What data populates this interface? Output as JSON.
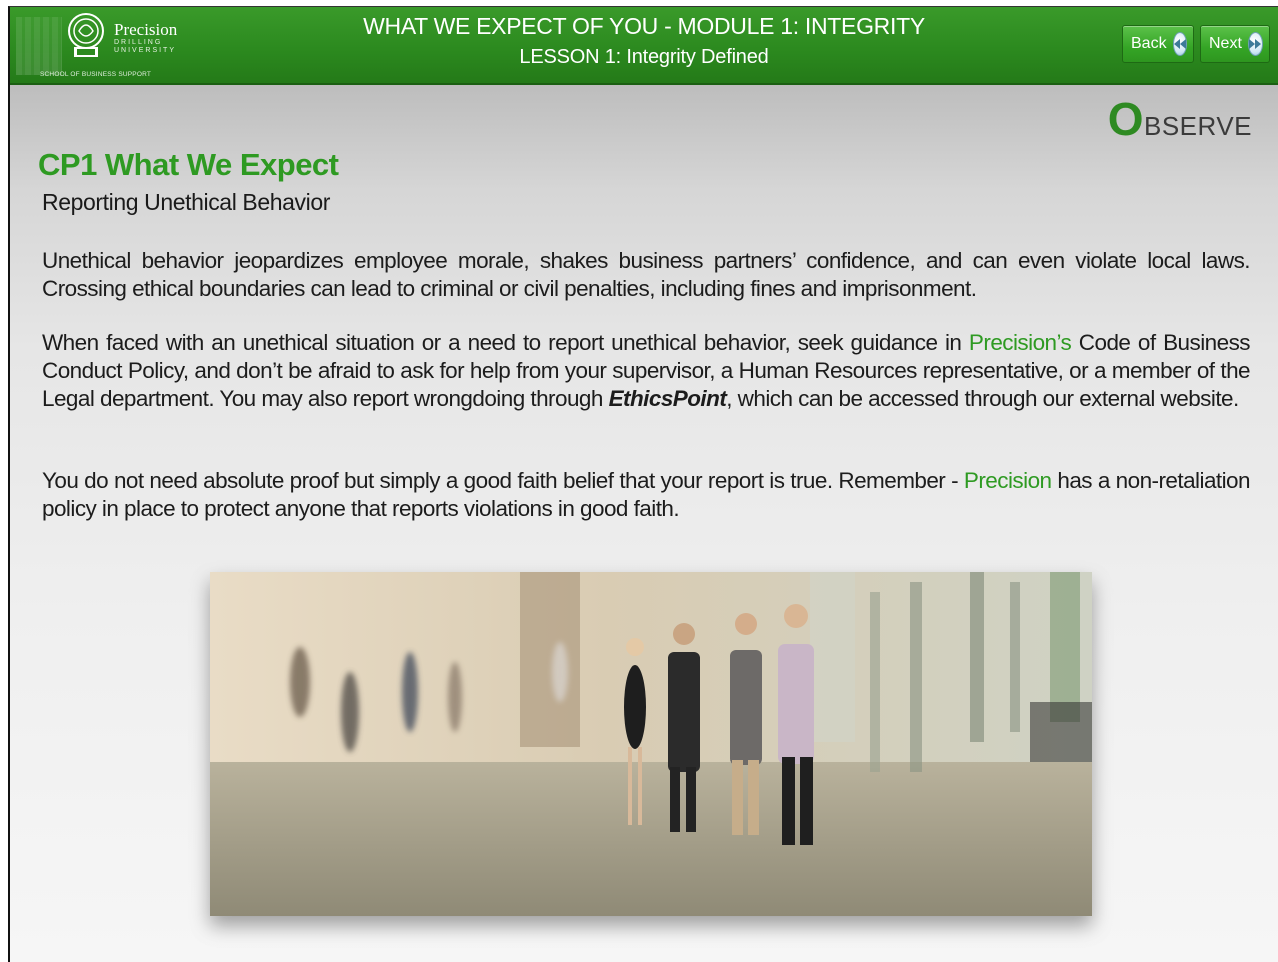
{
  "header": {
    "logo": {
      "name": "Precision",
      "subtitle": "DRILLING UNIVERSITY",
      "school": "SCHOOL OF BUSINESS SUPPORT"
    },
    "title": "WHAT WE EXPECT OF YOU - MODULE 1: INTEGRITY",
    "lesson": "LESSON 1: Integrity Defined",
    "back_label": "Back",
    "next_label": "Next",
    "back_icon": "rewind-icon",
    "next_icon": "forward-icon"
  },
  "observe": {
    "initial": "O",
    "rest": "BSERVE"
  },
  "main": {
    "heading": "CP1 What We Expect",
    "subheading": "Reporting Unethical Behavior",
    "p1": "Unethical behavior jeopardizes employee morale, shakes business partners’ confidence, and can even violate local laws. Crossing ethical boundaries can lead to criminal or civil penalties, including fines and imprisonment.",
    "p2": {
      "a": "When faced with an unethical situation or a need to report unethical behavior, seek guidance in ",
      "brand": "Precision’s",
      "b": " Code of Business Conduct Policy, and don’t be afraid to ask for help from your supervisor, a Human Resources representative, or a member of the Legal department. You may also report wrongdoing through ",
      "ethics": "EthicsPoint",
      "c": ", which can be accessed through our external website."
    },
    "p3": {
      "a": "You do not need absolute proof but simply a good faith belief that your report is true. Remember - ",
      "brand": "Precision",
      "b": " has a non-retaliation policy in place to protect anyone that reports violations in good faith."
    }
  },
  "colors": {
    "brand_green": "#2e9a22",
    "header_green": "#2c8a1f"
  }
}
